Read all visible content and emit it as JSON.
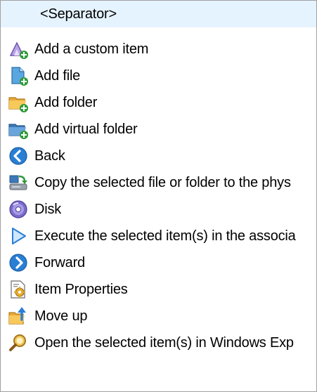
{
  "list": {
    "items": [
      {
        "label": "<Separator>",
        "icon": "none",
        "selected": true
      },
      {
        "label": "Add a custom item",
        "icon": "custom-item-add-icon"
      },
      {
        "label": "Add file",
        "icon": "file-add-icon"
      },
      {
        "label": "Add folder",
        "icon": "folder-add-icon"
      },
      {
        "label": "Add virtual folder",
        "icon": "virtual-folder-add-icon"
      },
      {
        "label": "Back",
        "icon": "back-arrow-icon"
      },
      {
        "label": "Copy the selected file or folder to the phys",
        "icon": "copy-to-physical-icon"
      },
      {
        "label": "Disk",
        "icon": "disk-icon"
      },
      {
        "label": "Execute the selected item(s) in the associa",
        "icon": "execute-play-icon"
      },
      {
        "label": "Forward",
        "icon": "forward-arrow-icon"
      },
      {
        "label": "Item Properties",
        "icon": "item-properties-icon"
      },
      {
        "label": "Move up",
        "icon": "move-up-folder-icon"
      },
      {
        "label": "Open the selected item(s) in Windows Exp",
        "icon": "open-in-explorer-icon"
      }
    ]
  },
  "colors": {
    "selection": "#e5f3ff",
    "border": "#a0a0a0",
    "text": "#000000"
  }
}
